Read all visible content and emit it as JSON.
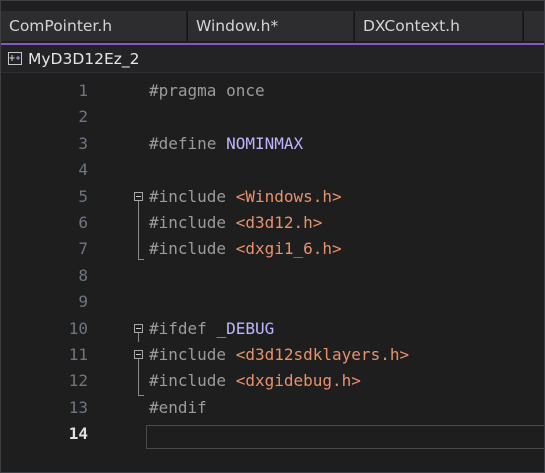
{
  "tabs": [
    {
      "label": "ComPointer.h"
    },
    {
      "label": "Window.h*"
    },
    {
      "label": "DXContext.h"
    }
  ],
  "nav": {
    "project_label": "MyD3D12Ez_2",
    "icon": "project-file-icon"
  },
  "colors": {
    "accent": "#8657c8",
    "keyword_preprocessor": "#9b9b9b",
    "macro": "#bdb6ff",
    "string": "#e8916e"
  },
  "editor": {
    "current_line": "14",
    "lines": [
      {
        "number": "1",
        "tokens": [
          {
            "t": "#pragma once",
            "k": "pp"
          }
        ]
      },
      {
        "number": "2",
        "tokens": []
      },
      {
        "number": "3",
        "tokens": [
          {
            "t": "#define",
            "k": "pp"
          },
          {
            "t": " ",
            "k": "ws"
          },
          {
            "t": "NOMINMAX",
            "k": "macro"
          }
        ]
      },
      {
        "number": "4",
        "tokens": []
      },
      {
        "number": "5",
        "tokens": [
          {
            "t": "#include",
            "k": "pp"
          },
          {
            "t": " ",
            "k": "ws"
          },
          {
            "t": "<Windows.h>",
            "k": "str"
          }
        ]
      },
      {
        "number": "6",
        "tokens": [
          {
            "t": "#include",
            "k": "pp"
          },
          {
            "t": " ",
            "k": "ws"
          },
          {
            "t": "<d3d12.h>",
            "k": "str"
          }
        ]
      },
      {
        "number": "7",
        "tokens": [
          {
            "t": "#include",
            "k": "pp"
          },
          {
            "t": " ",
            "k": "ws"
          },
          {
            "t": "<dxgi1_6.h>",
            "k": "str"
          }
        ]
      },
      {
        "number": "8",
        "tokens": []
      },
      {
        "number": "9",
        "tokens": []
      },
      {
        "number": "10",
        "tokens": [
          {
            "t": "#ifdef",
            "k": "pp"
          },
          {
            "t": " ",
            "k": "ws"
          },
          {
            "t": "_DEBUG",
            "k": "macro"
          }
        ]
      },
      {
        "number": "11",
        "tokens": [
          {
            "t": "#include",
            "k": "pp"
          },
          {
            "t": " ",
            "k": "ws"
          },
          {
            "t": "<d3d12sdklayers.h>",
            "k": "str"
          }
        ]
      },
      {
        "number": "12",
        "tokens": [
          {
            "t": "#include",
            "k": "pp"
          },
          {
            "t": " ",
            "k": "ws"
          },
          {
            "t": "<dxgidebug.h>",
            "k": "str"
          }
        ]
      },
      {
        "number": "13",
        "tokens": [
          {
            "t": "#endif",
            "k": "pp"
          }
        ]
      },
      {
        "number": "14",
        "tokens": []
      }
    ]
  }
}
